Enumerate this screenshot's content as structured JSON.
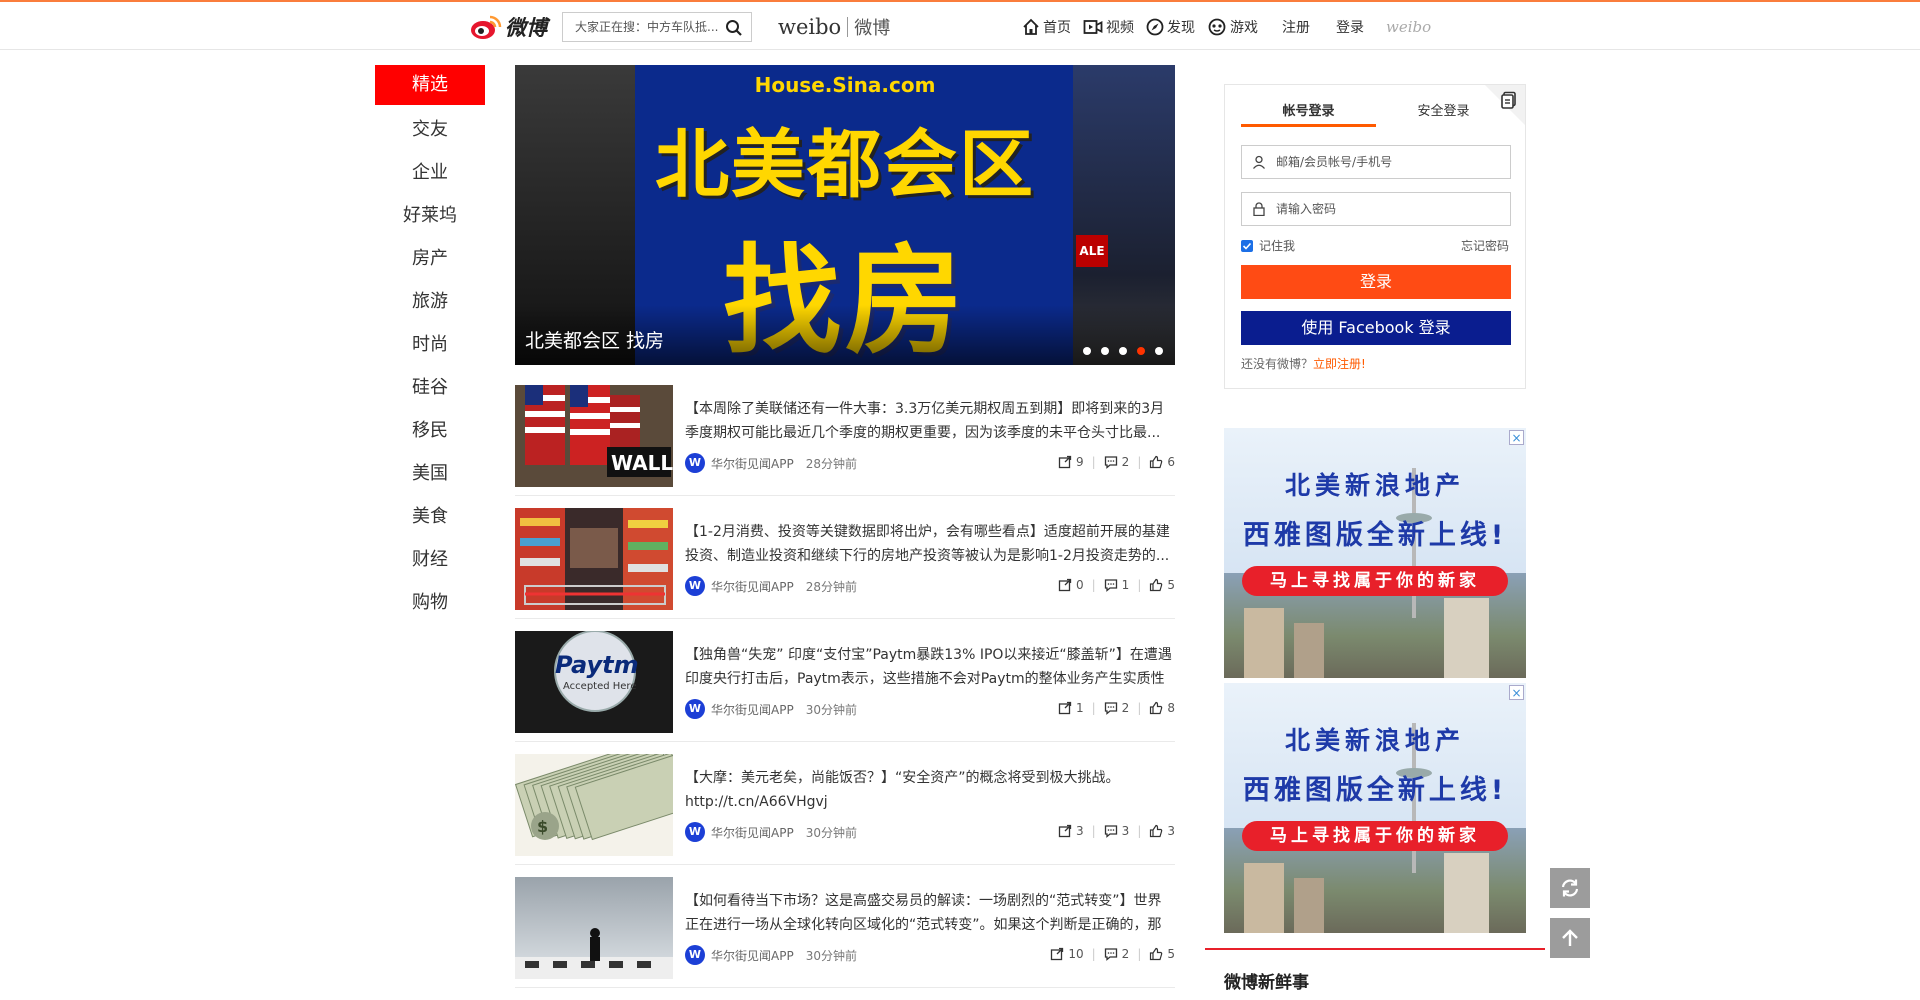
{
  "header": {
    "logo_text": "微博",
    "search_placeholder": "大家正在搜：中方车队抵...",
    "brand_en": "weibo",
    "brand_cn": "微博",
    "nav": [
      {
        "label": "首页",
        "icon": "home-icon"
      },
      {
        "label": "视频",
        "icon": "video-icon"
      },
      {
        "label": "发现",
        "icon": "compass-icon"
      },
      {
        "label": "游戏",
        "icon": "gamepad-icon"
      }
    ],
    "register": "注册",
    "login": "登录",
    "small_logo": "weibo"
  },
  "sidebar": {
    "items": [
      "精选",
      "交友",
      "企业",
      "好莱坞",
      "房产",
      "旅游",
      "时尚",
      "硅谷",
      "移民",
      "美国",
      "美食",
      "财经",
      "购物"
    ]
  },
  "banner": {
    "site": "House.Sina.com",
    "headline1": "北美都会区",
    "headline2": "找房",
    "sale_sign": "ALE",
    "caption": "北美都会区 找房",
    "dot_count": 5,
    "active_dot": 4
  },
  "feed": [
    {
      "title": "【本周除了美联储还有一件大事：3.3万亿美元期权周五到期】即将到来的3月季度期权可能比最近几个季度的期权更重要，因为该季度的未平仓头寸比最...",
      "source": "华尔街见闻APP",
      "time": "28分钟前",
      "reposts": "9",
      "comments": "2",
      "likes": "6",
      "thumb": "wall-street"
    },
    {
      "title": "【1-2月消费、投资等关键数据即将出炉，会有哪些看点】适度超前开展的基建投资、制造业投资和继续下行的房地产投资等被认为是影响1-2月投资走势的...",
      "source": "华尔街见闻APP",
      "time": "28分钟前",
      "reposts": "0",
      "comments": "1",
      "likes": "5",
      "thumb": "supermarket"
    },
    {
      "title": "【独角兽“失宠” 印度“支付宝”Paytm暴跌13% IPO以来接近“膝盖斩”】在遭遇印度央行打击后，Paytm表示，这些措施不会对Paytm的整体业务产生实质性的...",
      "source": "华尔街见闻APP",
      "time": "30分钟前",
      "reposts": "1",
      "comments": "2",
      "likes": "8",
      "thumb": "paytm"
    },
    {
      "title": "【大摩：美元老矣，尚能饭否？】“安全资产”的概念将受到极大挑战。http://t.cn/A66VHgvj",
      "source": "华尔街见闻APP",
      "time": "30分钟前",
      "reposts": "3",
      "comments": "3",
      "likes": "3",
      "thumb": "dollars"
    },
    {
      "title": "【如何看待当下市场？这是高盛交易员的解读：一场剧烈的“范式转变”】世界正在进行一场从全球化转向区域化的“范式转变”。如果这个判断是正确的，那么...",
      "source": "华尔街见闻APP",
      "time": "30分钟前",
      "reposts": "10",
      "comments": "2",
      "likes": "5",
      "thumb": "chess"
    }
  ],
  "thumb_labels": {
    "wall": "WALL",
    "paytm": "Paytm",
    "paytm_sub": "Accepted Here"
  },
  "login": {
    "tab_account": "帐号登录",
    "tab_secure": "安全登录",
    "user_placeholder": "邮箱/会员帐号/手机号",
    "pass_placeholder": "请输入密码",
    "remember": "记住我",
    "forgot": "忘记密码",
    "login_button": "登录",
    "facebook_button": "使用 Facebook 登录",
    "no_account": "还没有微博？",
    "register_now": "立即注册!"
  },
  "ads": [
    {
      "line1": "北美新浪地产",
      "line2": "西雅图版全新上线!",
      "pill": "马上寻找属于你的新家",
      "close": "×"
    },
    {
      "line1": "北美新浪地产",
      "line2": "西雅图版全新上线!",
      "pill": "马上寻找属于你的新家",
      "close": "×"
    }
  ],
  "fresh_title": "微博新鲜事",
  "colors": {
    "accent": "#ff0000",
    "login_orange": "#ff4b14",
    "facebook_blue": "#0a1d8f",
    "source_blue": "#1c3fd6"
  }
}
